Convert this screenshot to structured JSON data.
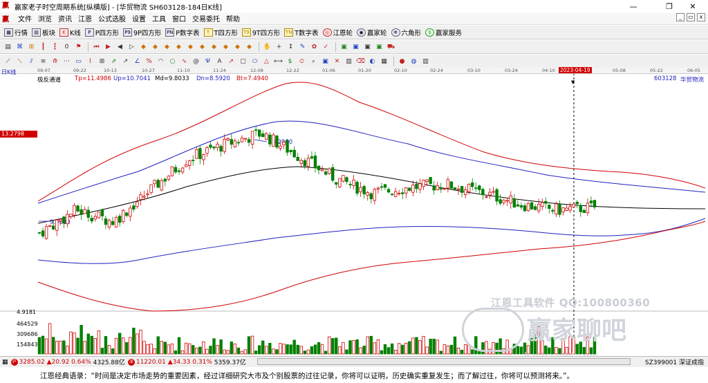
{
  "window": {
    "title": "赢家老子时空周期系统[纵横版] - [华贸物流  SH603128-184日K线]",
    "minimize": "—",
    "maximize": "❐",
    "close": "✕"
  },
  "menu": [
    "文件",
    "浏览",
    "资讯",
    "江恩",
    "公式选股",
    "设置",
    "工具",
    "窗口",
    "交易委托",
    "帮助"
  ],
  "toolbar1": [
    {
      "label": "行情",
      "icon": "grid-icon"
    },
    {
      "label": "板块",
      "icon": "blocks-icon"
    },
    {
      "label": "K线",
      "icon": "kline-icon"
    },
    {
      "label": "P四方形",
      "icon": "p-square-icon"
    },
    {
      "label": "9P四方形",
      "icon": "9p-square-icon"
    },
    {
      "label": "P数字表",
      "icon": "p-table-icon"
    },
    {
      "label": "T四方形",
      "icon": "t-square-icon"
    },
    {
      "label": "9T四方形",
      "icon": "9t-square-icon"
    },
    {
      "label": "T数字表",
      "icon": "t-table-icon"
    },
    {
      "label": "江恩轮",
      "icon": "gann-wheel-icon"
    },
    {
      "label": "赢家轮",
      "icon": "winner-wheel-icon"
    },
    {
      "label": "六角形",
      "icon": "hexagon-icon"
    },
    {
      "label": "赢家服务",
      "icon": "service-icon"
    }
  ],
  "chart": {
    "period_label": "日K线",
    "indicator_name": "极反通道",
    "tp": "Tp=11.4986",
    "up": "Up=10.7041",
    "md": "Md=9.8033",
    "dn": "Dn=8.5920",
    "bt": "Bt=7.4940",
    "stock_code": "603128",
    "stock_name": "华贸物流",
    "cursor_price": "13.2798",
    "high_label": "13.2000",
    "low_label": "9.0600",
    "highlight_date": "2023-04-19",
    "dates": [
      "09-07",
      "09-22",
      "10-13",
      "10-27",
      "11-10",
      "11-24",
      "12-08",
      "12-22",
      "01-06",
      "01-20",
      "02-10",
      "02-24",
      "03-10",
      "03-24",
      "04-10",
      "05-08",
      "05-22",
      "06-05"
    ],
    "volume_max": "4.9181",
    "volume_ticks": [
      "464529",
      "309686",
      "154843"
    ]
  },
  "chart_data": {
    "type": "candlestick",
    "title": "华贸物流 SH603128 日K线",
    "ylim": [
      6.5,
      15.0
    ],
    "x": [
      "09-07",
      "09-22",
      "10-13",
      "10-27",
      "11-10",
      "11-24",
      "12-08",
      "12-22",
      "01-06",
      "01-20",
      "02-10",
      "02-24",
      "03-10",
      "03-24",
      "04-10",
      "04-19"
    ],
    "close_approx": [
      9.2,
      10.0,
      9.6,
      10.7,
      11.8,
      12.3,
      12.7,
      11.9,
      11.1,
      10.6,
      10.8,
      10.9,
      10.6,
      10.2,
      10.0,
      10.1
    ],
    "series": [
      {
        "name": "Tp",
        "values": [
          11.4986
        ]
      },
      {
        "name": "Up",
        "values": [
          10.7041
        ]
      },
      {
        "name": "Md",
        "values": [
          9.8033
        ]
      },
      {
        "name": "Dn",
        "values": [
          8.592
        ]
      },
      {
        "name": "Bt",
        "values": [
          7.494
        ]
      }
    ],
    "annotations": [
      "13.2000",
      "9.0600"
    ]
  },
  "status": {
    "sh_index": "3285.02",
    "sh_change": "▲20.92",
    "sh_pct": "0.64%",
    "sh_amount": "4325.88亿",
    "sz_index": "11220.01",
    "sz_change": "▲34.33",
    "sz_pct": "0.31%",
    "sz_amount": "5359.37亿",
    "right_text": "SZ399001 深证成指"
  },
  "quote": "江恩经典语录：“时间是决定市场走势的重要因素，经过详细研究大市及个别股票的过往记录，你将可以证明，历史确实重复发生；而了解过往，你将可以预测将来。”。",
  "watermark": {
    "line1": "江恩工具软件  QQ:100800360",
    "line2": "赢家聊吧",
    "line3": "liaoba.yjbt.com"
  },
  "colors": {
    "up": "#d00000",
    "down": "#008000",
    "band_outer": "#d00000",
    "band_inner": "#2020c0",
    "midline": "#000000",
    "accent": "#d00000"
  }
}
